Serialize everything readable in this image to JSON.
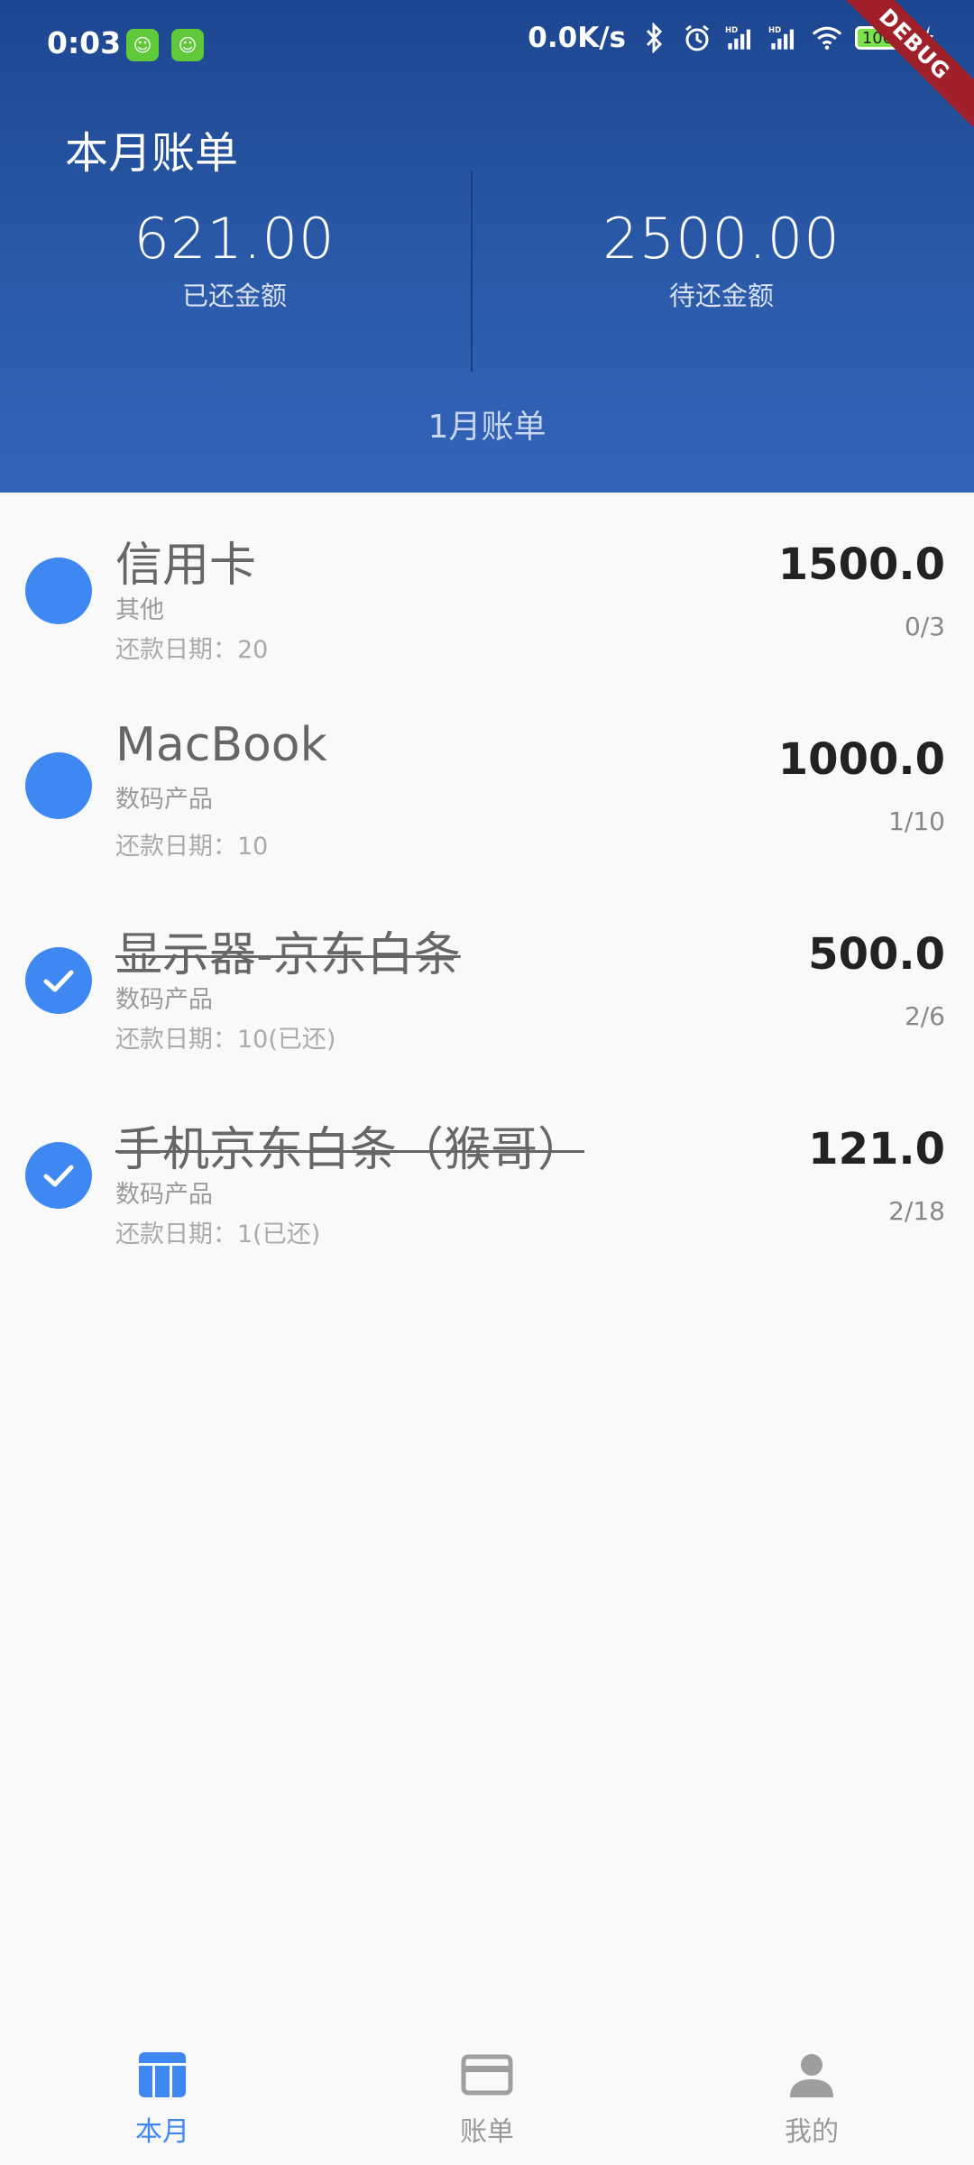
{
  "status_bar": {
    "time": "0:03",
    "net_speed": "0.0K/s",
    "battery": "100",
    "debug_ribbon": "DEBUG",
    "icons": [
      "app-icon",
      "app-icon",
      "bluetooth-icon",
      "alarm-icon",
      "signal-hd-icon",
      "signal-hd-icon",
      "wifi-icon",
      "battery-icon",
      "charging-icon"
    ]
  },
  "header": {
    "title": "本月账单",
    "paid_amount": "621.00",
    "paid_label": "已还金额",
    "pending_amount": "2500.00",
    "pending_label": "待还金额",
    "month_label": "1月账单"
  },
  "items": [
    {
      "title": "信用卡",
      "category": "其他",
      "date": "还款日期：20",
      "amount": "1500.0",
      "progress": "0/3",
      "checked": false
    },
    {
      "title": "MacBook",
      "category": "数码产品",
      "date": "还款日期：10",
      "amount": "1000.0",
      "progress": "1/10",
      "checked": false
    },
    {
      "title": "显示器-京东白条",
      "category": "数码产品",
      "date": "还款日期：10(已还)",
      "amount": "500.0",
      "progress": "2/6",
      "checked": true
    },
    {
      "title": "手机京东白条（猴哥）",
      "category": "数码产品",
      "date": "还款日期：1(已还)",
      "amount": "121.0",
      "progress": "2/18",
      "checked": true
    }
  ],
  "bottom_nav": [
    {
      "label": "本月",
      "icon": "calendar-grid-icon",
      "active": true
    },
    {
      "label": "账单",
      "icon": "credit-card-icon",
      "active": false
    },
    {
      "label": "我的",
      "icon": "person-icon",
      "active": false
    }
  ],
  "colors": {
    "header_top": "#1d4690",
    "header_bottom": "#3364bb",
    "accent": "#3f88f2",
    "background": "#f9f9fa"
  }
}
